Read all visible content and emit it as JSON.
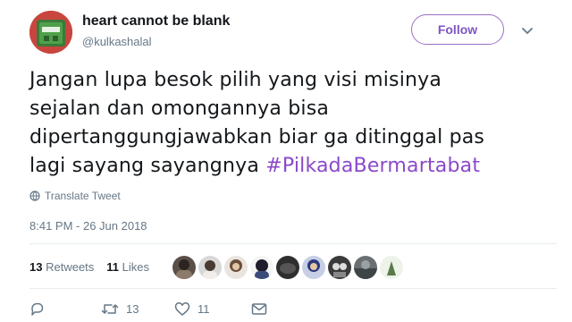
{
  "tweet": {
    "display_name": "heart cannot be blank",
    "handle": "@kulkashalal",
    "follow_label": "Follow",
    "text_lines": [
      "Jangan lupa besok pilih yang visi misinya",
      "sejalan dan omongannya bisa",
      "dipertanggungjawabkan biar ga ditinggal pas",
      "lagi sayang sayangnya "
    ],
    "hashtag": "#PilkadaBermartabat",
    "translate_label": "Translate Tweet",
    "timestamp": "8:41 PM - 26 Jun 2018",
    "retweets_count": "13",
    "retweets_label": "Retweets",
    "likes_count": "11",
    "likes_label": "Likes",
    "reply_count": "",
    "retweet_action_count": "13",
    "like_action_count": "11"
  },
  "icons": {
    "reply": "reply-icon",
    "retweet": "retweet-icon",
    "like": "heart-icon",
    "dm": "envelope-icon",
    "more": "chevron-down-icon",
    "translate": "globe-icon"
  },
  "colors": {
    "accent": "#8a49c9",
    "follow_border": "#9b6fc7",
    "muted": "#657786",
    "text": "#14171a"
  }
}
